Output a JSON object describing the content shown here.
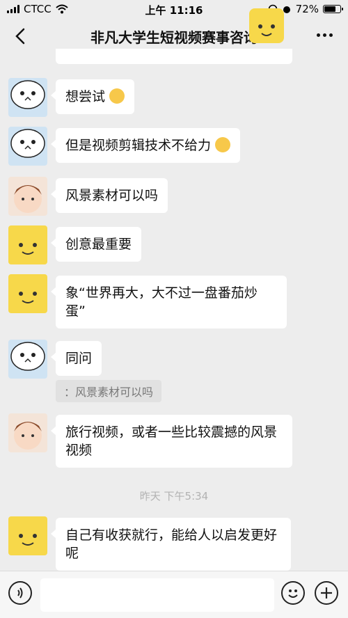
{
  "status_bar": {
    "carrier": "CTCC",
    "time": "上午 11:16",
    "battery": "72%",
    "battery_level": 0.72
  },
  "header": {
    "title": "非凡大学生短视频赛事咨询"
  },
  "messages": [
    {
      "avatar": "sticker-avatar",
      "text": "想尝试",
      "emoji": "star-eyes-emoji"
    },
    {
      "avatar": "sticker-avatar",
      "text": "但是视频剪辑技术不给力",
      "emoji": "pleading-emoji"
    },
    {
      "avatar": "boy-avatar",
      "text": "风景素材可以吗"
    },
    {
      "avatar": "yellow-avatar",
      "text": "创意最重要"
    },
    {
      "avatar": "yellow-avatar",
      "text": "象“世界再大，大不过一盘番茄炒蛋”"
    },
    {
      "avatar": "sticker-avatar",
      "text": "同问"
    },
    {
      "avatar": "boy-avatar",
      "text": "旅行视频，或者一些比较震撼的风景视频"
    },
    {
      "avatar": "yellow-avatar",
      "text": "自己有收获就行，能给人以启发更好呢"
    }
  ],
  "quote": {
    "text": "：风景素材可以吗"
  },
  "timestamp": "昨天 下午5:34",
  "colors": {
    "background": "#ededed",
    "bubble": "#ffffff",
    "quote": "#e1e1e1"
  }
}
